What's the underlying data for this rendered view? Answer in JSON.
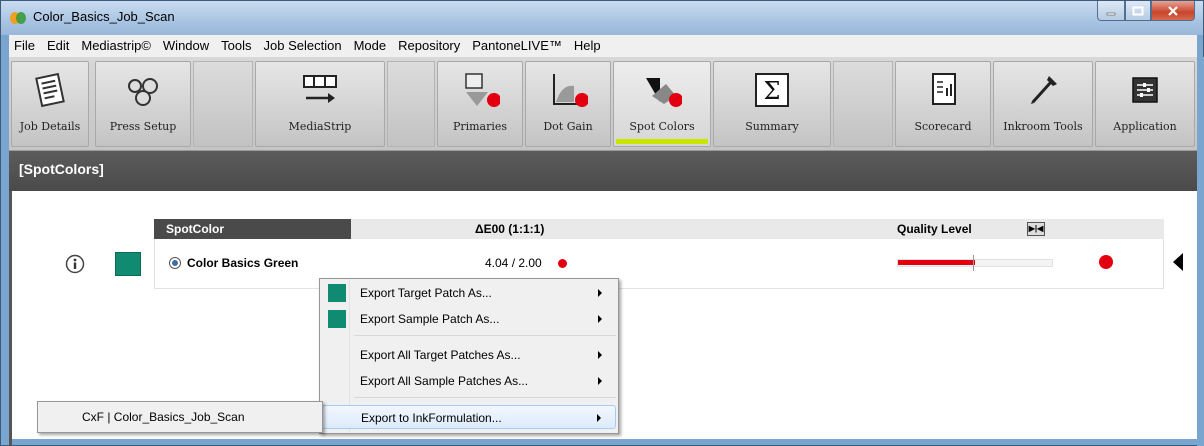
{
  "window": {
    "title": "Color_Basics_Job_Scan",
    "accent": "#7aa5cf"
  },
  "menu": [
    "File",
    "Edit",
    "Mediastrip©",
    "Window",
    "Tools",
    "Job Selection",
    "Mode",
    "Repository",
    "PantoneLIVE™",
    "Help"
  ],
  "toolbar": {
    "job_details": "Job Details",
    "press_setup": "Press Setup",
    "mediastrip": "MediaStrip",
    "primaries": "Primaries",
    "dot_gain": "Dot Gain",
    "spot_colors": "Spot Colors",
    "summary": "Summary",
    "scorecard": "Scorecard",
    "inkroom_tools": "Inkroom Tools",
    "application": "Application"
  },
  "section": {
    "title": "[SpotColors]"
  },
  "table": {
    "col_spotcolor": "SpotColor",
    "col_delta": "ΔE00 (1:1:1)",
    "col_quality": "Quality Level",
    "row": {
      "name": "Color Basics Green",
      "delta": "4.04 / 2.00",
      "swatch_color": "#108b71",
      "quality_fraction": 0.5,
      "status_color": "#e20010"
    }
  },
  "context_menu": {
    "items": [
      "Export Target Patch As...",
      "Export Sample Patch As...",
      "Export All Target Patches As...",
      "Export All Sample Patches As...",
      "Export to InkFormulation..."
    ]
  },
  "submenu": {
    "item": "CxF | Color_Basics_Job_Scan"
  }
}
